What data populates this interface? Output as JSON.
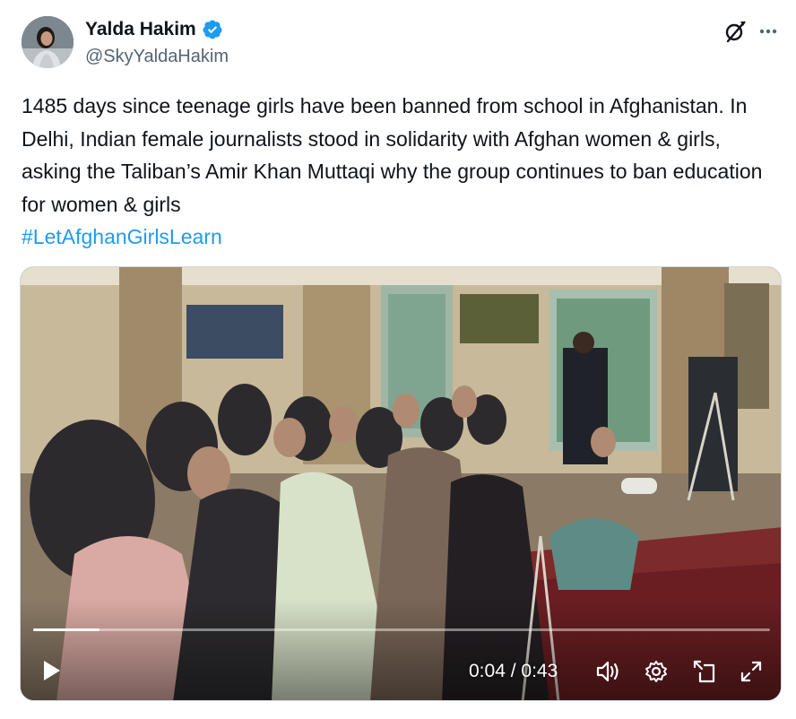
{
  "author": {
    "display_name": "Yalda Hakim",
    "handle": "@SkyYaldaHakim",
    "verified": true,
    "avatar_icon": "profile-photo"
  },
  "header_actions": {
    "grok_icon": "grok-icon",
    "more_icon": "more-options-icon"
  },
  "tweet": {
    "text": "1485 days since teenage girls have been banned from school in Afghanistan. In Delhi, Indian female journalists stood in solidarity with Afghan women & girls, asking the Taliban’s Amir Khan Muttaqi why the group continues to ban education for women & girls",
    "hashtag": "#LetAfghanGirlsLearn"
  },
  "video": {
    "current_time": "0:04",
    "duration": "0:43",
    "time_display": "0:04 / 0:43",
    "progress": 0.09,
    "controls": {
      "play_icon": "play-icon",
      "volume_icon": "volume-icon",
      "settings_icon": "settings-gear-icon",
      "popout_icon": "pop-out-icon",
      "fullscreen_icon": "fullscreen-icon"
    }
  },
  "colors": {
    "link": "#1d9bf0",
    "verified_badge": "#1d9bf0",
    "secondary_text": "#536471"
  }
}
